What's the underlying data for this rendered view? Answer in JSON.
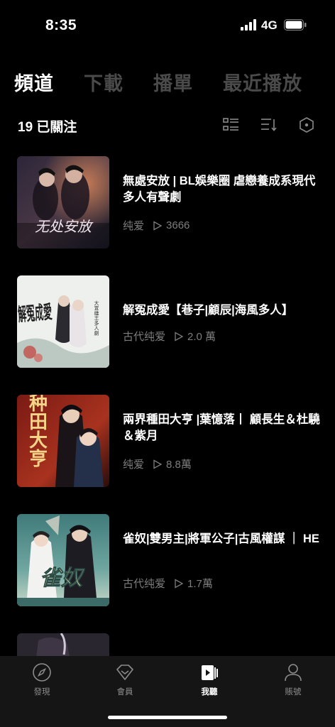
{
  "status_bar": {
    "time": "8:35",
    "network": "4G"
  },
  "tabs": [
    {
      "label": "頻道",
      "active": true
    },
    {
      "label": "下載",
      "active": false
    },
    {
      "label": "播單",
      "active": false
    },
    {
      "label": "最近播放",
      "active": false
    }
  ],
  "subheader": {
    "follow_count": "19 已關注"
  },
  "channels": [
    {
      "title": "無處安放 | BL娛樂圈 虐戀養成系現代多人有聲劇",
      "category": "纯爱",
      "plays": "3666",
      "cover_text": "无处安放"
    },
    {
      "title": "解冤成愛【巷子|顧辰|海風多人】",
      "category": "古代纯爱",
      "plays": "2.0 萬",
      "cover_text": "解冤成愛"
    },
    {
      "title": "兩界種田大亨 |葉憶落丨 顧長生＆杜驍＆紫月",
      "category": "纯爱",
      "plays": "8.8萬",
      "cover_text": "种田大亨"
    },
    {
      "title": "雀奴|雙男主|將軍公子|古風權謀 ｜ HE",
      "category": "古代纯爱",
      "plays": "1.7萬",
      "cover_text": "雀奴"
    }
  ],
  "bottom_nav": [
    {
      "label": "發現",
      "icon": "compass-icon",
      "active": false
    },
    {
      "label": "會員",
      "icon": "diamond-icon",
      "active": false
    },
    {
      "label": "我聽",
      "icon": "playlist-icon",
      "active": true
    },
    {
      "label": "賬號",
      "icon": "person-icon",
      "active": false
    }
  ],
  "colors": {
    "background": "#000000",
    "inactive_tab": "#4a4a4a",
    "meta_text": "#7d7d7d",
    "nav_bg": "#151515"
  }
}
